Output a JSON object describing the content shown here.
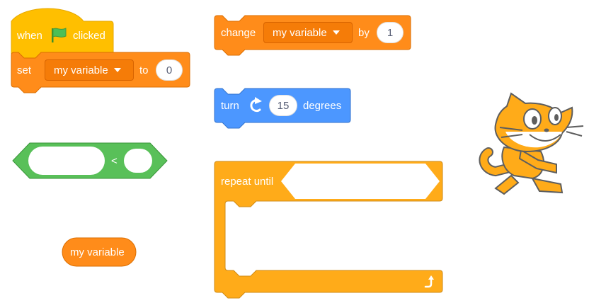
{
  "colors": {
    "events": "#ffbf00",
    "variables": "#ff8c1a",
    "motion": "#4c97ff",
    "operators": "#59c059",
    "control": "#ffab19"
  },
  "blocks": {
    "when_flag": {
      "prefix": "when",
      "suffix": "clicked",
      "icon": "green-flag-icon"
    },
    "set_var": {
      "label": "set",
      "variable": "my variable",
      "to_label": "to",
      "value": "0"
    },
    "change_var": {
      "label": "change",
      "variable": "my variable",
      "by_label": "by",
      "value": "1"
    },
    "turn": {
      "label": "turn",
      "icon": "rotate-right-icon",
      "value": "15",
      "unit": "degrees"
    },
    "less_than": {
      "operator": "<",
      "left": "",
      "right": ""
    },
    "reporter": {
      "label": "my variable"
    },
    "repeat_until": {
      "label": "repeat until",
      "loop_icon": "loop-arrow-icon"
    }
  },
  "sprite": {
    "name": "scratch-cat",
    "icon": "cat-sprite-icon"
  }
}
